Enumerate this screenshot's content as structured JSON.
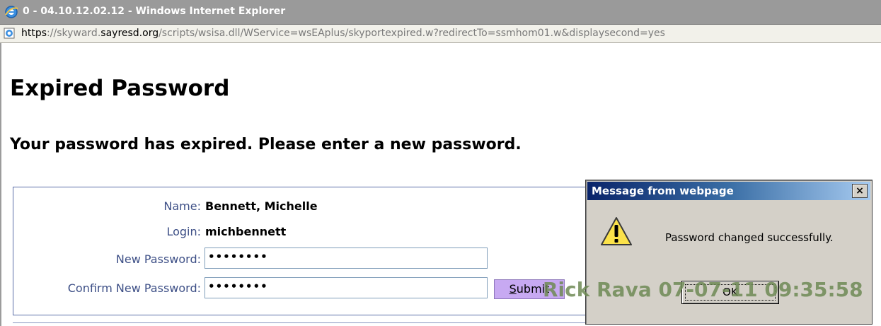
{
  "window": {
    "title": "0 - 04.10.12.02.12 - Windows Internet Explorer"
  },
  "address_bar": {
    "scheme": "https",
    "separator": "://",
    "subdomain": "skyward.",
    "domain": "sayresd.org",
    "path": "/scripts/wsisa.dll/WService=wsEAplus/skyportexpired.w?redirectTo=ssmhom01.w&displaysecond=yes"
  },
  "page": {
    "heading": "Expired Password",
    "subheading": "Your password has expired. Please enter a new password."
  },
  "form": {
    "name_label": "Name:",
    "name_value": "Bennett, Michelle",
    "login_label": "Login:",
    "login_value": "michbennett",
    "new_password_label": "New Password:",
    "new_password_value": "••••••••",
    "confirm_password_label": "Confirm New Password:",
    "confirm_password_value": "••••••••",
    "submit_first": "S",
    "submit_rest": "ubmit"
  },
  "dialog": {
    "title": "Message from webpage",
    "close_label": "×",
    "message": "Password changed successfully.",
    "ok_label": "OK",
    "icon": "warning-icon"
  },
  "watermark": {
    "text": "Rick Rava 07-07-11 09:35:58"
  }
}
